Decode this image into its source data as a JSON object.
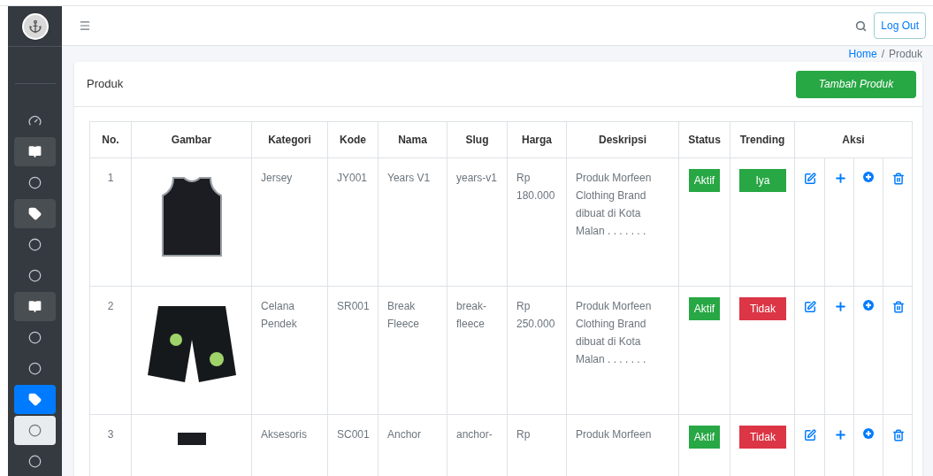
{
  "sidebar": {
    "items": [
      {
        "kind": "dashboard",
        "expanded": false,
        "selected": false,
        "hovered": false
      },
      {
        "kind": "book",
        "expanded": true,
        "selected": false,
        "hovered": false
      },
      {
        "kind": "circle",
        "expanded": false,
        "selected": false,
        "hovered": false
      },
      {
        "kind": "tag",
        "expanded": true,
        "selected": false,
        "hovered": false
      },
      {
        "kind": "circle",
        "expanded": false,
        "selected": false,
        "hovered": false
      },
      {
        "kind": "circle",
        "expanded": false,
        "selected": false,
        "hovered": false
      },
      {
        "kind": "book",
        "expanded": true,
        "selected": false,
        "hovered": false
      },
      {
        "kind": "circle",
        "expanded": false,
        "selected": false,
        "hovered": false
      },
      {
        "kind": "circle",
        "expanded": false,
        "selected": false,
        "hovered": false
      },
      {
        "kind": "tag",
        "selected": true,
        "hovered": false
      },
      {
        "kind": "circle",
        "selected": false,
        "hovered": true
      },
      {
        "kind": "circle",
        "expanded": false,
        "selected": false,
        "hovered": false
      }
    ]
  },
  "navbar": {
    "logout": "Log Out"
  },
  "breadcrumb": [
    {
      "label": "Home",
      "link": true
    },
    {
      "label": "/",
      "link": false
    },
    {
      "label": "Produk",
      "link": false
    }
  ],
  "card": {
    "title": "Produk",
    "add_button": "Tambah Produk"
  },
  "table": {
    "columns": [
      "No.",
      "Gambar",
      "Kategori",
      "Kode",
      "Nama",
      "Slug",
      "Harga",
      "Deskripsi",
      "Status",
      "Trending",
      "Aksi"
    ],
    "rows": [
      {
        "no": "1",
        "image": {
          "kind": "jersey"
        },
        "kategori": "Jersey",
        "kode": "JY001",
        "nama": "Years V1",
        "slug": "years-v1",
        "harga": "Rp 180.000",
        "deskripsi": "Produk Morfeen Clothing Brand dibuat di Kota Malan . . . . . . .",
        "status": {
          "label": "Aktif",
          "active": true
        },
        "trending": {
          "label": "Iya",
          "on": true
        }
      },
      {
        "no": "2",
        "image": {
          "kind": "shorts"
        },
        "kategori": "Celana Pendek",
        "kode": "SR001",
        "nama": "Break Fleece",
        "slug": "break- fleece",
        "harga": "Rp 250.000",
        "deskripsi": "Produk Morfeen Clothing Brand dibuat di Kota Malan . . . . . . .",
        "status": {
          "label": "Aktif",
          "active": true
        },
        "trending": {
          "label": "Tidak",
          "on": false
        }
      },
      {
        "no": "3",
        "image": {
          "kind": "accessory"
        },
        "kategori": "Aksesoris",
        "kode": "SC001",
        "nama": "Anchor",
        "slug": "anchor-",
        "harga": "Rp",
        "deskripsi": "Produk Morfeen",
        "status": {
          "label": "Aktif",
          "active": true
        },
        "trending": {
          "label": "Tidak",
          "on": false
        }
      }
    ]
  }
}
